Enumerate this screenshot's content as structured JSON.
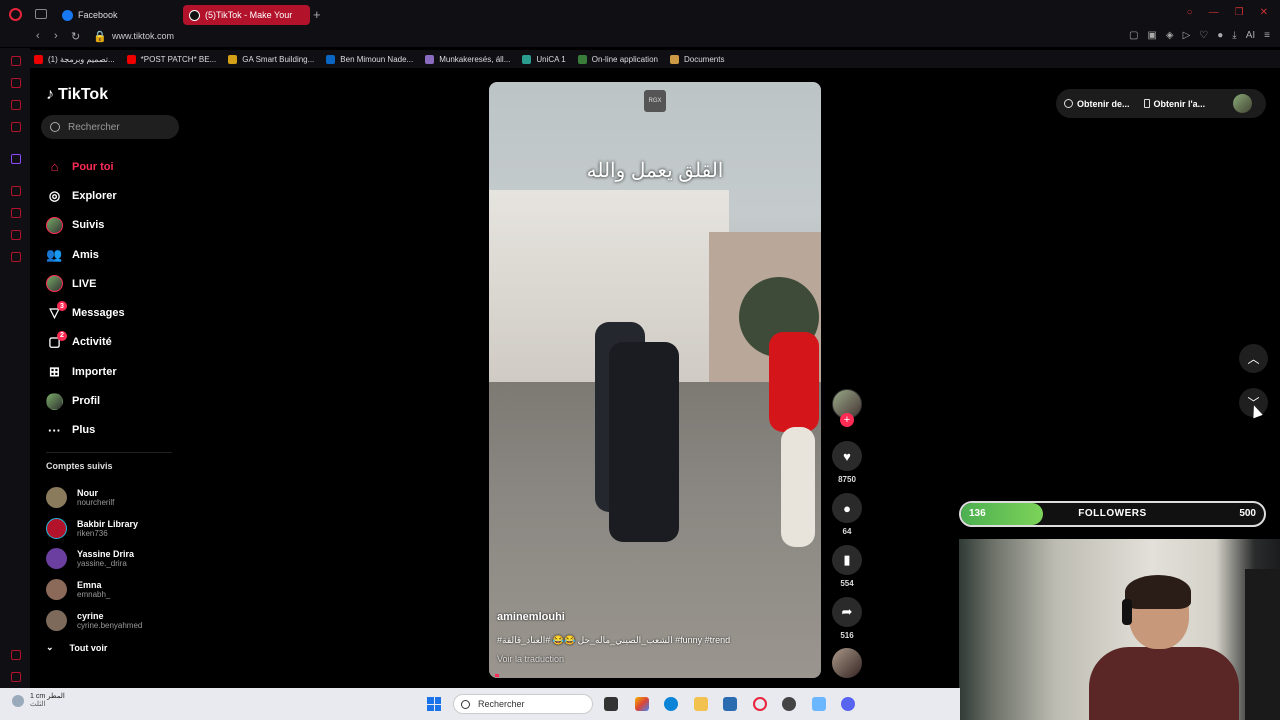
{
  "browser": {
    "tabs": [
      {
        "label": "Facebook"
      },
      {
        "label": "(5)TikTok - Make Your"
      }
    ],
    "url": "www.tiktok.com",
    "bookmarks": [
      {
        "label": "(1) تصميم وبرمجة..."
      },
      {
        "label": "*POST PATCH* BE..."
      },
      {
        "label": "GA Smart Building..."
      },
      {
        "label": "Ben Mimoun Nade..."
      },
      {
        "label": "Munkakeresés, áll..."
      },
      {
        "label": "UniCA 1"
      },
      {
        "label": "On-line application"
      },
      {
        "label": "Documents"
      }
    ]
  },
  "tiktok": {
    "logo": "TikTok",
    "search_placeholder": "Rechercher",
    "menu": [
      {
        "label": "Pour toi",
        "icon": "home-icon",
        "active": true
      },
      {
        "label": "Explorer",
        "icon": "compass-icon"
      },
      {
        "label": "Suivis",
        "icon": "avatar-icon"
      },
      {
        "label": "Amis",
        "icon": "friends-icon"
      },
      {
        "label": "LIVE",
        "icon": "live-avatar-icon"
      },
      {
        "label": "Messages",
        "icon": "messages-icon",
        "badge": "3"
      },
      {
        "label": "Activité",
        "icon": "activity-icon",
        "badge": "2"
      },
      {
        "label": "Importer",
        "icon": "upload-icon"
      },
      {
        "label": "Profil",
        "icon": "profile-avatar-icon"
      },
      {
        "label": "Plus",
        "icon": "more-icon"
      }
    ],
    "following_title": "Comptes suivis",
    "following": [
      {
        "name": "Nour",
        "username": "nourcherilf",
        "color": "#8a7b5c"
      },
      {
        "name": "Bakbir Library",
        "username": "riken736",
        "color": "#b3122b"
      },
      {
        "name": "Yassine Drira",
        "username": "yassine._drira",
        "color": "#6b3fa0"
      },
      {
        "name": "Emna",
        "username": "emnabh_",
        "color": "#8c6a5a"
      },
      {
        "name": "cyrine",
        "username": "cyrine.benyahmed",
        "color": "#7d6a5a"
      }
    ],
    "see_all": "Tout voir"
  },
  "video": {
    "watermark": "RGX",
    "overlay_text": "القلق يعمل والله",
    "author": "aminemlouhi",
    "description": "#الشعب_الصيني_ماله_حل 😂😂 #العباد_قالقة #funny #trend",
    "translate": "Voir la traduction",
    "progress_percent": 1
  },
  "actions": {
    "likes": "8750",
    "comments": "64",
    "saves": "554",
    "shares": "516"
  },
  "top_right": {
    "get_coins": "Obtenir de...",
    "get_app": "Obtenir l'a..."
  },
  "goal": {
    "current": "136",
    "label": "FOLLOWERS",
    "target": "500",
    "progress_fraction": 0.27,
    "fill_color": "#5cc447"
  },
  "taskbar": {
    "weather_line1": "1 cm المطر",
    "weather_line2": "الثلث",
    "search_placeholder": "Rechercher"
  }
}
